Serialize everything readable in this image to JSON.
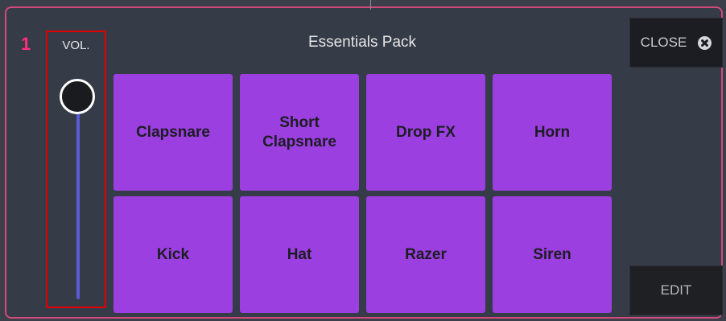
{
  "slot": {
    "number": "1"
  },
  "volume": {
    "label": "VOL.",
    "level": 1.0
  },
  "pack": {
    "title": "Essentials Pack"
  },
  "pads": [
    {
      "label": "Clapsnare"
    },
    {
      "label": "Short\nClapsnare"
    },
    {
      "label": "Drop FX"
    },
    {
      "label": "Horn"
    },
    {
      "label": "Kick"
    },
    {
      "label": "Hat"
    },
    {
      "label": "Razer"
    },
    {
      "label": "Siren"
    }
  ],
  "buttons": {
    "close_label": "CLOSE",
    "edit_label": "EDIT"
  },
  "colors": {
    "pad": "#9b3fe0",
    "accent_number": "#ff2f7a",
    "highlight_box": "#e00000",
    "panel_border": "#d24a7a",
    "volume_track": "#5a5bd6"
  },
  "icons": {
    "close": "close-circle-icon",
    "volume_knob": "slider-knob"
  }
}
